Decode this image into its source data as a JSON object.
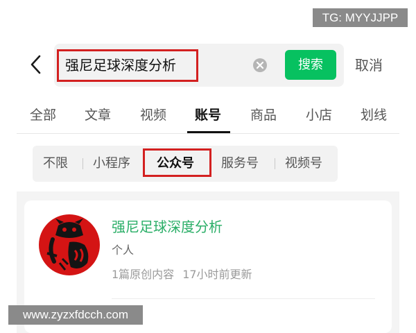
{
  "watermarks": {
    "top": "TG: MYYJJPP",
    "bottom": "www.zyzxfdcch.com"
  },
  "search": {
    "query": "强尼足球深度分析",
    "submit_label": "搜索",
    "cancel_label": "取消"
  },
  "tabs": [
    {
      "label": "全部"
    },
    {
      "label": "文章"
    },
    {
      "label": "视频"
    },
    {
      "label": "账号",
      "active": true
    },
    {
      "label": "商品"
    },
    {
      "label": "小店"
    },
    {
      "label": "划线"
    }
  ],
  "filters": [
    {
      "label": "不限"
    },
    {
      "label": "小程序"
    },
    {
      "label": "公众号",
      "active": true
    },
    {
      "label": "服务号"
    },
    {
      "label": "视频号"
    }
  ],
  "result": {
    "name": "强尼足球深度分析",
    "type": "个人",
    "articles": "1篇原创内容",
    "updated": "17小时前更新"
  },
  "colors": {
    "accent_green": "#07c160",
    "name_green": "#2aae67",
    "highlight_red": "#d32020"
  },
  "icons": [
    "back-chevron-icon",
    "clear-icon"
  ]
}
